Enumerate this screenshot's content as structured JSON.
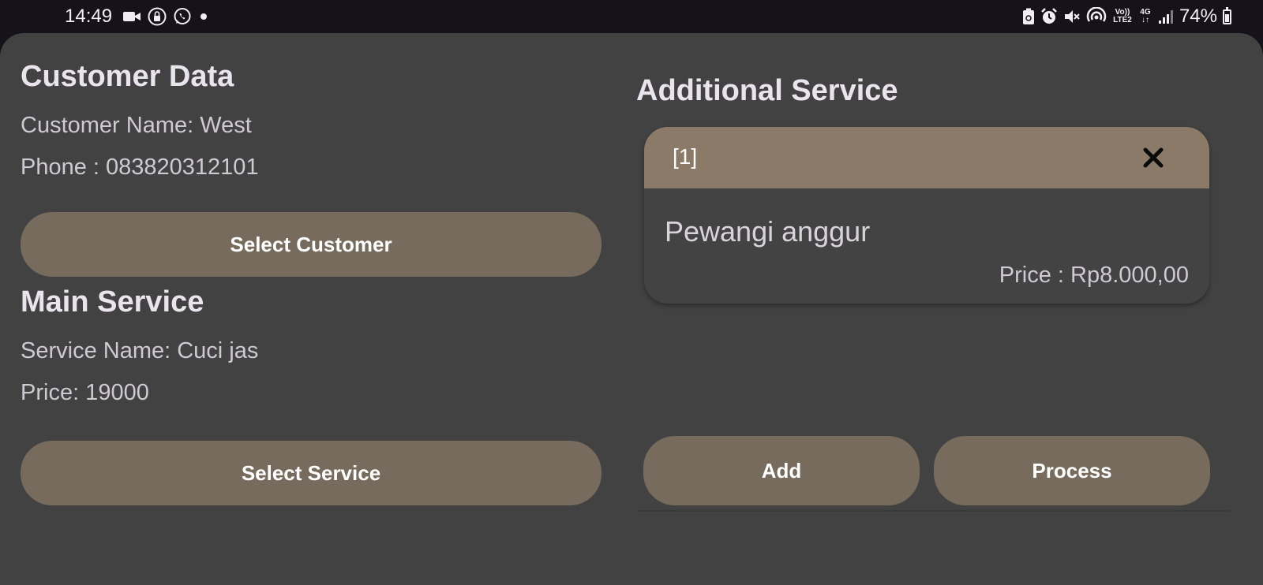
{
  "status_bar": {
    "time": "14:49",
    "battery_pct": "74%",
    "battery_level": 0.74,
    "network_label": "4G",
    "volte_label": "Vo)) LTE2",
    "icons_left": [
      "video-camera-icon",
      "lock-circle-icon",
      "whatsapp-icon",
      "dot-icon"
    ],
    "icons_right": [
      "battery-saver-icon",
      "alarm-icon",
      "mute-icon",
      "hotspot-icon",
      "volte-icon",
      "data-4g-icon",
      "signal-icon",
      "battery-icon"
    ]
  },
  "customer": {
    "heading": "Customer Data",
    "name_row": "Customer Name:  West",
    "phone_row": "Phone : 083820312101",
    "select_button": "Select Customer"
  },
  "main_service": {
    "heading": "Main Service",
    "name_row": "Service Name:  Cuci jas",
    "price_row": "Price:  19000",
    "select_button": "Select Service"
  },
  "additional": {
    "heading": "Additional Service",
    "items": [
      {
        "index": "[1]",
        "name": "Pewangi anggur",
        "price": "Price : Rp8.000,00"
      }
    ]
  },
  "actions": {
    "add": "Add",
    "process": "Process"
  },
  "colors": {
    "sheet_bg": "#424242",
    "button_bg": "#766b5d",
    "card_header": "#8a7a67",
    "status_bar_bg": "#151219"
  }
}
